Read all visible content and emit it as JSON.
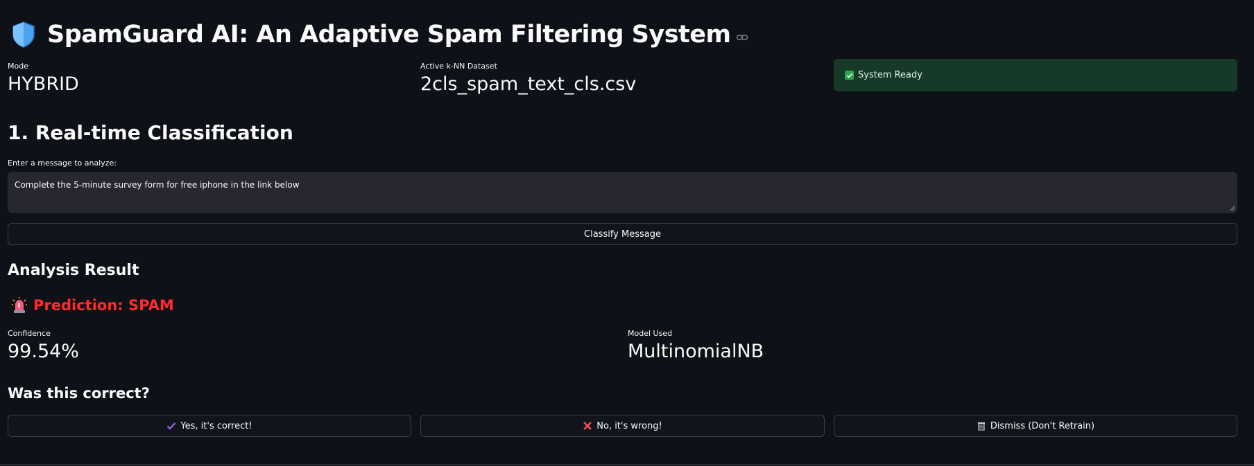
{
  "header": {
    "title": "SpamGuard AI: An Adaptive Spam Filtering System",
    "shield_icon": "shield-icon",
    "link_icon": "link-icon"
  },
  "metrics": {
    "mode_label": "Mode",
    "mode_value": "HYBRID",
    "dataset_label": "Active k-NN Dataset",
    "dataset_value": "2cls_spam_text_cls.csv"
  },
  "status": {
    "text": "System Ready",
    "icon": "check-box-icon",
    "color": "#173928"
  },
  "classification": {
    "heading": "1. Real-time Classification",
    "input_label": "Enter a message to analyze:",
    "input_value": "Complete the 5-minute survey form for free iphone in the link below",
    "classify_button": "Classify Message"
  },
  "result": {
    "heading": "Analysis Result",
    "prediction_text": "Prediction: SPAM",
    "prediction_color": "#ff2b2b",
    "prediction_icon": "siren-icon",
    "confidence_label": "Confidence",
    "confidence_value": "99.54%",
    "model_label": "Model Used",
    "model_value": "MultinomialNB"
  },
  "feedback": {
    "heading": "Was this correct?",
    "yes_button": "Yes, it's correct!",
    "no_button": "No, it's wrong!",
    "dismiss_button": "Dismiss (Don't Retrain)"
  },
  "colors": {
    "background": "#0e1117",
    "accent_purple": "#8a63d2",
    "error_red": "#ff4b4b"
  }
}
